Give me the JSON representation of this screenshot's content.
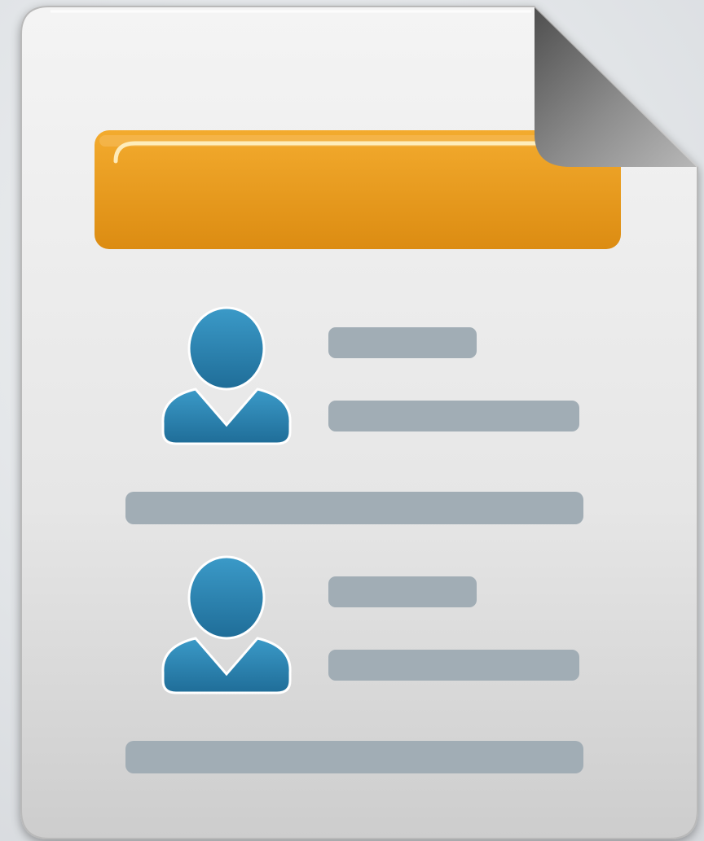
{
  "icon": {
    "name": "contact-list-document-icon",
    "glyph": "document-with-user-entries",
    "colors": {
      "paper_light": "#f3f3f3",
      "paper_dark": "#cfcfcf",
      "paper_border": "#bdbdbd",
      "header_bar_top": "#f3ab2e",
      "header_bar_bottom": "#dc8c12",
      "user_blue_light": "#3a97c4",
      "user_blue_dark": "#1f6f9a",
      "text_line": "#a1adb5",
      "fold_light": "#9a9a9a",
      "fold_dark": "#5a5a5a"
    },
    "entries": [
      {
        "name": "entry-1",
        "avatar": "user-icon"
      },
      {
        "name": "entry-2",
        "avatar": "user-icon"
      }
    ]
  }
}
